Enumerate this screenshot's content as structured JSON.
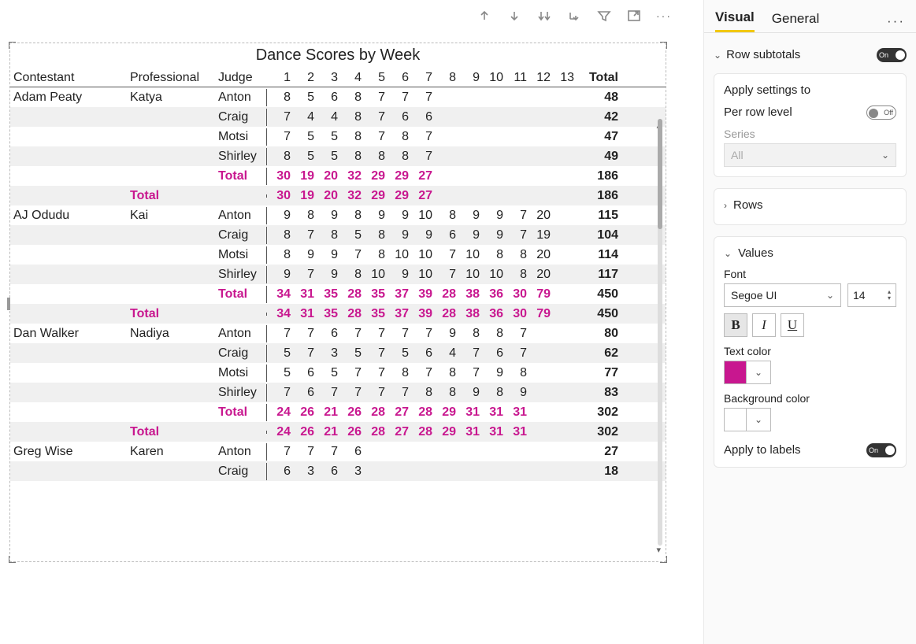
{
  "visual": {
    "title": "Dance Scores by Week",
    "header": {
      "contestant": "Contestant",
      "professional": "Professional",
      "judge": "Judge",
      "weeks": [
        "1",
        "2",
        "3",
        "4",
        "5",
        "6",
        "7",
        "8",
        "9",
        "10",
        "11",
        "12",
        "13"
      ],
      "total": "Total"
    },
    "groups": [
      {
        "contestant": "Adam Peaty",
        "professional": "Katya",
        "rows": [
          {
            "judge": "Anton",
            "w": [
              "8",
              "5",
              "6",
              "8",
              "7",
              "7",
              "7",
              "",
              "",
              "",
              "",
              "",
              ""
            ],
            "total": "48"
          },
          {
            "judge": "Craig",
            "w": [
              "7",
              "4",
              "4",
              "8",
              "7",
              "6",
              "6",
              "",
              "",
              "",
              "",
              "",
              ""
            ],
            "total": "42"
          },
          {
            "judge": "Motsi",
            "w": [
              "7",
              "5",
              "5",
              "8",
              "7",
              "8",
              "7",
              "",
              "",
              "",
              "",
              "",
              ""
            ],
            "total": "47"
          },
          {
            "judge": "Shirley",
            "w": [
              "8",
              "5",
              "5",
              "8",
              "8",
              "8",
              "7",
              "",
              "",
              "",
              "",
              "",
              ""
            ],
            "total": "49"
          }
        ],
        "subtotal": {
          "label": "Total",
          "w": [
            "30",
            "19",
            "20",
            "32",
            "29",
            "29",
            "27",
            "",
            "",
            "",
            "",
            "",
            ""
          ],
          "total": "186"
        },
        "grand": {
          "label": "Total",
          "w": [
            "30",
            "19",
            "20",
            "32",
            "29",
            "29",
            "27",
            "",
            "",
            "",
            "",
            "",
            ""
          ],
          "total": "186"
        }
      },
      {
        "contestant": "AJ Odudu",
        "professional": "Kai",
        "rows": [
          {
            "judge": "Anton",
            "w": [
              "9",
              "8",
              "9",
              "8",
              "9",
              "9",
              "10",
              "8",
              "9",
              "9",
              "7",
              "20",
              ""
            ],
            "total": "115"
          },
          {
            "judge": "Craig",
            "w": [
              "8",
              "7",
              "8",
              "5",
              "8",
              "9",
              "9",
              "6",
              "9",
              "9",
              "7",
              "19",
              ""
            ],
            "total": "104"
          },
          {
            "judge": "Motsi",
            "w": [
              "8",
              "9",
              "9",
              "7",
              "8",
              "10",
              "10",
              "7",
              "10",
              "8",
              "8",
              "20",
              ""
            ],
            "total": "114"
          },
          {
            "judge": "Shirley",
            "w": [
              "9",
              "7",
              "9",
              "8",
              "10",
              "9",
              "10",
              "7",
              "10",
              "10",
              "8",
              "20",
              ""
            ],
            "total": "117"
          }
        ],
        "subtotal": {
          "label": "Total",
          "w": [
            "34",
            "31",
            "35",
            "28",
            "35",
            "37",
            "39",
            "28",
            "38",
            "36",
            "30",
            "79",
            ""
          ],
          "total": "450"
        },
        "grand": {
          "label": "Total",
          "w": [
            "34",
            "31",
            "35",
            "28",
            "35",
            "37",
            "39",
            "28",
            "38",
            "36",
            "30",
            "79",
            ""
          ],
          "total": "450"
        }
      },
      {
        "contestant": "Dan Walker",
        "professional": "Nadiya",
        "rows": [
          {
            "judge": "Anton",
            "w": [
              "7",
              "7",
              "6",
              "7",
              "7",
              "7",
              "7",
              "9",
              "8",
              "8",
              "7",
              "",
              ""
            ],
            "total": "80"
          },
          {
            "judge": "Craig",
            "w": [
              "5",
              "7",
              "3",
              "5",
              "7",
              "5",
              "6",
              "4",
              "7",
              "6",
              "7",
              "",
              ""
            ],
            "total": "62"
          },
          {
            "judge": "Motsi",
            "w": [
              "5",
              "6",
              "5",
              "7",
              "7",
              "8",
              "7",
              "8",
              "7",
              "9",
              "8",
              "",
              ""
            ],
            "total": "77"
          },
          {
            "judge": "Shirley",
            "w": [
              "7",
              "6",
              "7",
              "7",
              "7",
              "7",
              "8",
              "8",
              "9",
              "8",
              "9",
              "",
              ""
            ],
            "total": "83"
          }
        ],
        "subtotal": {
          "label": "Total",
          "w": [
            "24",
            "26",
            "21",
            "26",
            "28",
            "27",
            "28",
            "29",
            "31",
            "31",
            "31",
            "",
            ""
          ],
          "total": "302"
        },
        "grand": {
          "label": "Total",
          "w": [
            "24",
            "26",
            "21",
            "26",
            "28",
            "27",
            "28",
            "29",
            "31",
            "31",
            "31",
            "",
            ""
          ],
          "total": "302"
        }
      },
      {
        "contestant": "Greg Wise",
        "professional": "Karen",
        "rows": [
          {
            "judge": "Anton",
            "w": [
              "7",
              "7",
              "7",
              "6",
              "",
              "",
              "",
              "",
              "",
              "",
              "",
              "",
              ""
            ],
            "total": "27"
          },
          {
            "judge": "Craig",
            "w": [
              "6",
              "3",
              "6",
              "3",
              "",
              "",
              "",
              "",
              "",
              "",
              "",
              "",
              ""
            ],
            "total": "18"
          }
        ]
      }
    ]
  },
  "pane": {
    "tabs": {
      "visual": "Visual",
      "general": "General"
    },
    "rowSubtotals": {
      "title": "Row subtotals",
      "toggle": "On"
    },
    "applySettings": {
      "title": "Apply settings to",
      "perRowLevel": "Per row level",
      "perRowToggle": "Off",
      "seriesLabel": "Series",
      "seriesValue": "All"
    },
    "rows": {
      "title": "Rows"
    },
    "values": {
      "title": "Values",
      "fontLabel": "Font",
      "fontFamily": "Segoe UI",
      "fontSize": "14",
      "textColorLabel": "Text color",
      "bgColorLabel": "Background color",
      "applyLabelsLabel": "Apply to labels",
      "applyLabelsToggle": "On"
    }
  }
}
